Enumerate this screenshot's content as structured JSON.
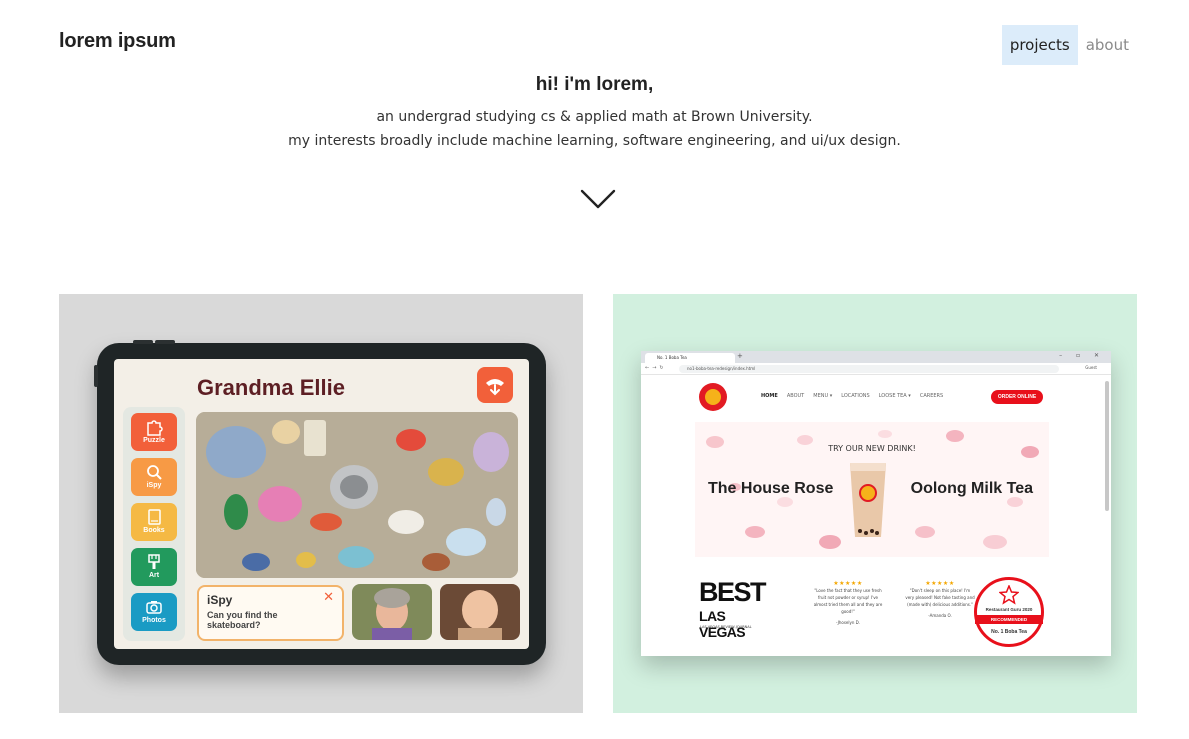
{
  "header": {
    "brand": "lorem ipsum",
    "nav": [
      {
        "label": "projects",
        "active": true
      },
      {
        "label": "about",
        "active": false
      }
    ]
  },
  "hero": {
    "greeting": "hi! i'm lorem,",
    "line1": "an undergrad studying cs & applied math at Brown University.",
    "line2": "my interests broadly include machine learning, software engineering, and ui/ux design."
  },
  "projects": [
    {
      "background": "#d9d9d9",
      "mockup": {
        "title": "Grandma Ellie",
        "apps": [
          "Puzzle",
          "iSpy",
          "Books",
          "Art",
          "Photos"
        ],
        "prompt_title": "iSpy",
        "prompt_text": "Can you find the skateboard?"
      }
    },
    {
      "background": "#d2f0df",
      "mockup": {
        "tab_title": "No. 1 Boba Tea",
        "url": "no1-boba-tea-redesign/index.html",
        "guest": "Guest",
        "nav": [
          "HOME",
          "ABOUT",
          "MENU ▾",
          "LOCATIONS",
          "LOOSE TEA ▾",
          "CAREERS"
        ],
        "order_button": "ORDER ONLINE",
        "promo": "TRY OUR NEW DRINK!",
        "drink_left": "The House Rose",
        "drink_right": "Oolong Milk Tea",
        "best_of": "BEST",
        "best_of_place": "LAS VEGAS",
        "best_of_sub": "LAS VEGAS REVIEW-JOURNAL",
        "reviews": [
          {
            "stars": "★★★★★",
            "text": "\"Love the fact that they use fresh fruit not powder or syrup! I've almost tried them all and they are good!\"",
            "author": "-Jhoselyn D."
          },
          {
            "stars": "★★★★★",
            "text": "\"Don't sleep on this place! I'm very pleased! Not fake tasting and (made with) delicious additions.\"",
            "author": "-Amanda O."
          }
        ],
        "badge_top": "Restaurant Guru 2020",
        "badge_mid": "RECOMMENDED",
        "badge_bottom": "No. 1 Boba Tea"
      }
    }
  ],
  "colors": {
    "nav_active_bg": "#dcecfa",
    "brand_red": "#e8101b",
    "ellie_accent": "#f2603a"
  }
}
